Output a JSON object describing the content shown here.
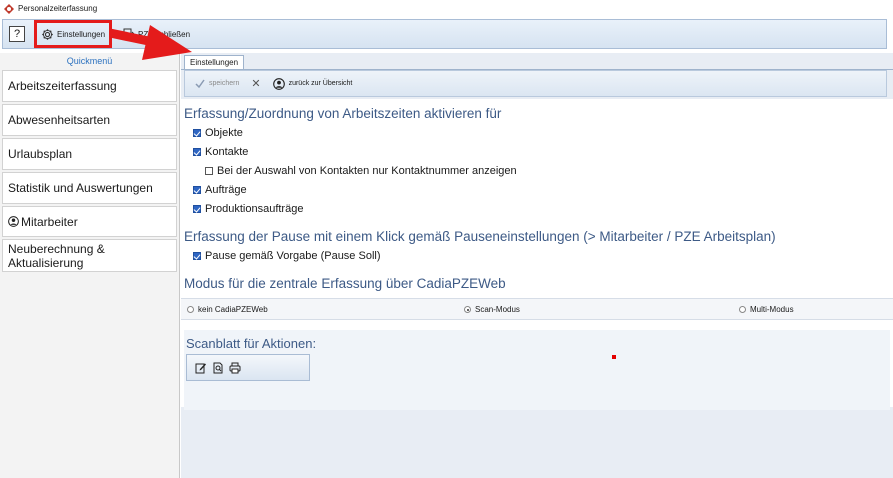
{
  "window": {
    "title": "Personalzeiterfassung"
  },
  "toolbar": {
    "help_label": "?",
    "settings_label": "Einstellungen",
    "close_label": "PZE schließen"
  },
  "sidebar": {
    "header": "Quickmenü",
    "items": [
      {
        "label": "Arbeitszeiterfassung"
      },
      {
        "label": "Abwesenheitsarten"
      },
      {
        "label": "Urlaubsplan"
      },
      {
        "label": "Statistik und Auswertungen"
      },
      {
        "label": "Mitarbeiter"
      },
      {
        "label": "Neuberechnung & Aktualisierung"
      }
    ]
  },
  "main": {
    "tab": "Einstellungen",
    "actions": {
      "save_label": "speichern",
      "cancel_symbol": "✕",
      "back_label": "zurück zur Übersicht"
    },
    "section1": {
      "title": "Erfassung/Zuordnung von Arbeitszeiten aktivieren für",
      "options": [
        {
          "label": "Objekte",
          "checked": true
        },
        {
          "label": "Kontakte",
          "checked": true
        },
        {
          "label": "Bei der Auswahl von Kontakten nur Kontaktnummer anzeigen",
          "checked": false
        },
        {
          "label": "Aufträge",
          "checked": true
        },
        {
          "label": "Produktionsaufträge",
          "checked": true
        }
      ]
    },
    "section2": {
      "title": "Erfassung der Pause mit einem Klick gemäß Pauseneinstellungen (> Mitarbeiter / PZE Arbeitsplan)",
      "option": {
        "label": "Pause gemäß Vorgabe (Pause Soll)",
        "checked": true
      }
    },
    "section3": {
      "title": "Modus für die zentrale Erfassung über CadiaPZEWeb",
      "modes": [
        {
          "label": "kein CadiaPZEWeb",
          "selected": false
        },
        {
          "label": "Scan-Modus",
          "selected": true
        },
        {
          "label": "Multi-Modus",
          "selected": false
        }
      ]
    },
    "scan": {
      "title": "Scanblatt für Aktionen:"
    }
  },
  "annotation_color": "#e41b1b"
}
